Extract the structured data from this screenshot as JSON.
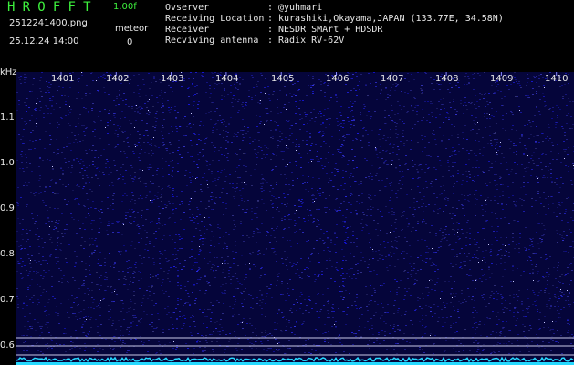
{
  "header": {
    "app_title": "HROFFT",
    "version": "1.00f",
    "filename": "2512241400.png",
    "datetime": "25.12.24 14:00",
    "meteor_label": "meteor",
    "meteor_count": "0"
  },
  "info": [
    {
      "key": "Ovserver",
      "value": "@yuhmari"
    },
    {
      "key": "Receiving Location",
      "value": "kurashiki,Okayama,JAPAN (133.77E, 34.58N)"
    },
    {
      "key": "Receiver",
      "value": "NESDR SMArt + HDSDR"
    },
    {
      "key": "Recviving antenna",
      "value": "Radix RV-62V"
    }
  ],
  "axis": {
    "y_unit": "kHz",
    "y_ticks": [
      "1.1",
      "1.0",
      "0.9",
      "0.8",
      "0.7",
      "0.6"
    ],
    "x_ticks": [
      "1401",
      "1402",
      "1403",
      "1404",
      "1405",
      "1406",
      "1407",
      "1408",
      "1409",
      "1410"
    ]
  },
  "colors": {
    "background": "#000000",
    "title_green": "#3df03d",
    "spectrum_bg": "#05053a",
    "noise_blue": "#2a2ad0",
    "baseline_cyan": "#26d9ff"
  }
}
